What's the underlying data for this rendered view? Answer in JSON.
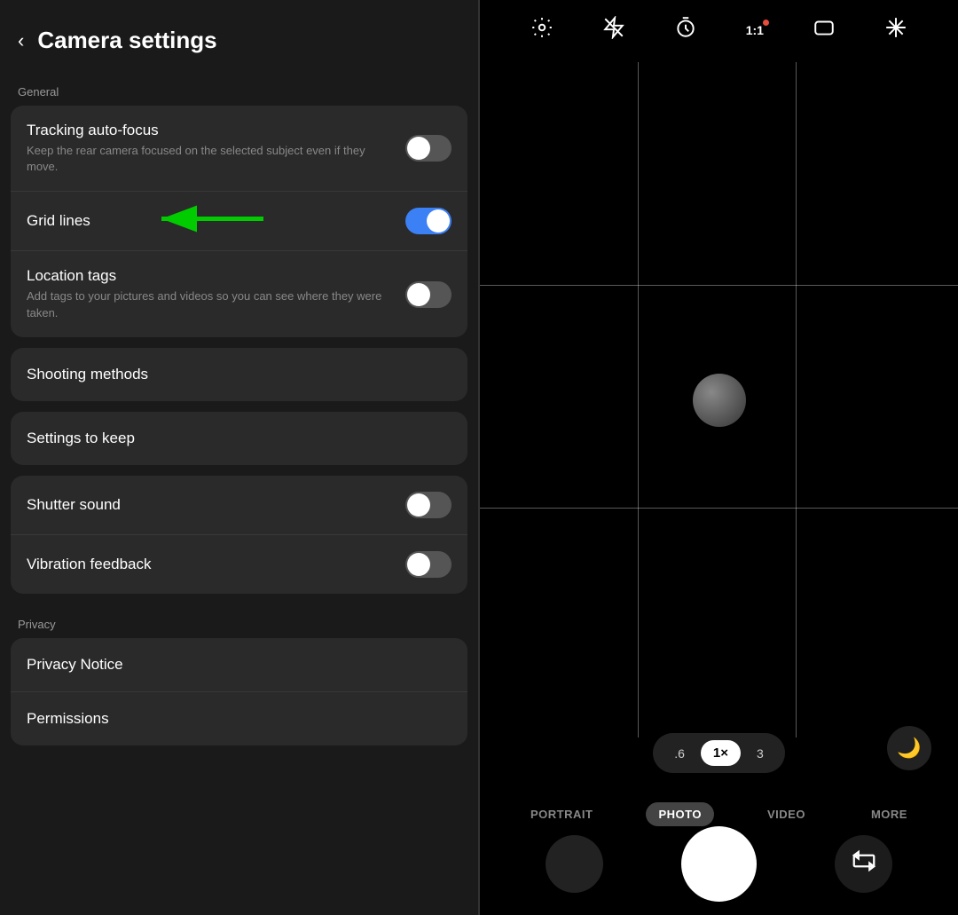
{
  "header": {
    "back_label": "‹",
    "title": "Camera settings"
  },
  "general_section": {
    "label": "General",
    "settings_group1": {
      "items": [
        {
          "id": "tracking_autofocus",
          "title": "Tracking auto-focus",
          "desc": "Keep the rear camera focused on the selected subject even if they move.",
          "toggle": "off"
        },
        {
          "id": "grid_lines",
          "title": "Grid lines",
          "desc": "",
          "toggle": "on-blue"
        },
        {
          "id": "location_tags",
          "title": "Location tags",
          "desc": "Add tags to your pictures and videos so you can see where they were taken.",
          "toggle": "off"
        }
      ]
    },
    "nav_items": [
      {
        "id": "shooting_methods",
        "title": "Shooting methods"
      },
      {
        "id": "settings_to_keep",
        "title": "Settings to keep"
      }
    ],
    "settings_group2": {
      "items": [
        {
          "id": "shutter_sound",
          "title": "Shutter sound",
          "desc": "",
          "toggle": "off"
        },
        {
          "id": "vibration_feedback",
          "title": "Vibration feedback",
          "desc": "",
          "toggle": "off"
        }
      ]
    }
  },
  "privacy_section": {
    "label": "Privacy",
    "nav_items": [
      {
        "id": "privacy_notice",
        "title": "Privacy Notice"
      },
      {
        "id": "permissions",
        "title": "Permissions"
      }
    ]
  },
  "camera": {
    "zoom_levels": [
      {
        "label": ".6",
        "active": false
      },
      {
        "label": "1×",
        "active": true
      },
      {
        "label": "3",
        "active": false
      }
    ],
    "modes": [
      {
        "label": "PORTRAIT",
        "active": false
      },
      {
        "label": "PHOTO",
        "active": true
      },
      {
        "label": "VIDEO",
        "active": false
      },
      {
        "label": "MORE",
        "active": false
      }
    ],
    "night_icon": "🌙",
    "flip_icon": "↺",
    "top_icons": [
      {
        "id": "settings",
        "symbol": "⚙",
        "has_dot": false
      },
      {
        "id": "flash",
        "symbol": "⚡",
        "has_dot": false,
        "crossed": true
      },
      {
        "id": "timer",
        "symbol": "⏱",
        "has_dot": false
      },
      {
        "id": "ratio",
        "symbol": "1:1",
        "has_dot": true
      },
      {
        "id": "shape",
        "symbol": "▱",
        "has_dot": false
      },
      {
        "id": "filter",
        "symbol": "✳",
        "has_dot": false
      }
    ]
  }
}
